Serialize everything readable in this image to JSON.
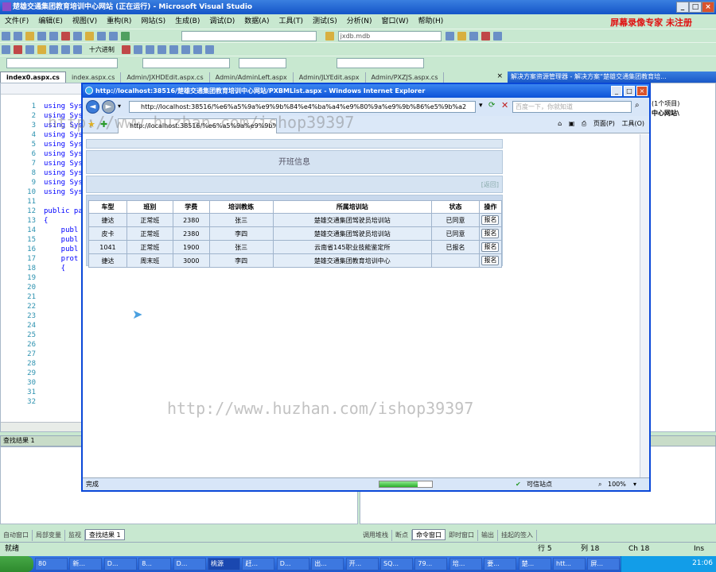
{
  "vs": {
    "title": "楚雄交通集团教育培训中心网站 (正在运行) - Microsoft Visual Studio",
    "menu": [
      "文件(F)",
      "编辑(E)",
      "视图(V)",
      "重构(R)",
      "网站(S)",
      "生成(B)",
      "调试(D)",
      "数据(A)",
      "工具(T)",
      "测试(S)",
      "分析(N)",
      "窗口(W)",
      "帮助(H)"
    ],
    "brand": "屏幕录像专家  未注册",
    "toolbar_db": "jxdb.mdb",
    "toolbar_hex": "十六进制",
    "doc_tabs": [
      "index0.aspx.cs",
      "index.aspx.cs",
      "Admin/JXHDEdit.aspx.cs",
      "Admin/AdminLeft.aspx",
      "Admin/JLYEdit.aspx",
      "Admin/PXZJS.aspx.cs"
    ],
    "solution_title": "解决方案资源管理器 - 解决方案“楚雄交通集团教育培...",
    "solution_items": [
      "(1个项目)",
      "中心网站\\"
    ],
    "line_numbers": [
      "1",
      "2",
      "3",
      "4",
      "5",
      "6",
      "7",
      "8",
      "9",
      "10",
      "11",
      "12",
      "13",
      "14",
      "15",
      "16",
      "17",
      "18",
      "19",
      "20",
      "21",
      "22",
      "23",
      "24",
      "25",
      "26",
      "27",
      "28",
      "29",
      "30",
      "31",
      "32"
    ],
    "code_lines": [
      "using Sys",
      "using Sys",
      "using Sys",
      "using Sys",
      "using Sys",
      "using Sys",
      "using Sys",
      "using Sys",
      "using Sys",
      "using Sys",
      "",
      "public pa",
      "{",
      "    publ",
      "    publ",
      "    publ",
      "    prot",
      "    {"
    ],
    "find_title": "查找结果 1",
    "tool_tabs_left": [
      "自动窗口",
      "局部变量",
      "监视",
      "查找结果 1"
    ],
    "tool_tabs_right": [
      "调用堆栈",
      "断点",
      "命令窗口",
      "即时窗口",
      "输出",
      "挂起的签入"
    ],
    "status": {
      "ready": "就绪",
      "row": "行 5",
      "col": "列 18",
      "ch": "Ch 18",
      "ins": "Ins"
    },
    "taskbar": [
      "80",
      "新...",
      "D...",
      "8...",
      "D...",
      "桃源",
      "赶...",
      "D...",
      "出...",
      "开...",
      "SQ...",
      "79...",
      "培...",
      "要...",
      "楚...",
      "htt...",
      "屏..."
    ],
    "clock": "21:06"
  },
  "ie": {
    "title": "http://localhost:38516/楚雄交通集团教育培训中心网站/PXBMList.aspx - Windows Internet Explorer",
    "url": "http://localhost:38516/%e6%a5%9a%e9%9b%84%e4%ba%a4%e9%80%9a%e9%9b%86%e5%9b%a2",
    "tab_label": "http://localhost:38516/%e6%a5%9a%e9%9b%84...",
    "search_placeholder": "百度一下，你就知道",
    "cmd_page": "页面(P)",
    "cmd_tools": "工具(O)",
    "status_done": "完成",
    "status_zone": "可信站点",
    "zoom": "100%",
    "progress": 0.72
  },
  "page": {
    "heading": "开班信息",
    "back": "[返回]",
    "columns": [
      "车型",
      "班别",
      "学费",
      "培训教练",
      "所属培训站",
      "状态",
      "操作"
    ],
    "rows": [
      {
        "car": "捷达",
        "class": "正常班",
        "fee": "2380",
        "coach": "张三",
        "station": "楚雄交通集团驾驶员培训站",
        "status": "已同意",
        "action": "报名"
      },
      {
        "car": "皮卡",
        "class": "正常班",
        "fee": "2380",
        "coach": "李四",
        "station": "楚雄交通集团驾驶员培训站",
        "status": "已同意",
        "action": "报名"
      },
      {
        "car": "1041",
        "class": "正常班",
        "fee": "1900",
        "coach": "张三",
        "station": "云南省145职业技能鉴定所",
        "status": "已报名",
        "action": "报名"
      },
      {
        "car": "捷达",
        "class": "周末班",
        "fee": "3000",
        "coach": "李四",
        "station": "楚雄交通集团教育培训中心",
        "status": "",
        "action": "报名"
      }
    ]
  },
  "watermark": "http://www.huzhan.com/ishop39397"
}
